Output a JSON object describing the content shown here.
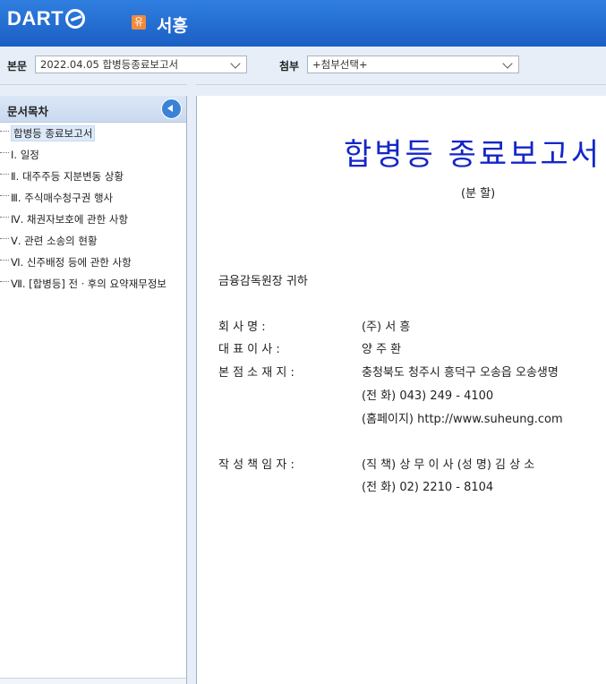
{
  "header": {
    "logo": "DART",
    "company_badge": "유",
    "company_name": "서흥"
  },
  "toolbar": {
    "main_label": "본문",
    "main_select": "2022.04.05  합병등종료보고서",
    "attach_label": "첨부",
    "attach_select": "+첨부선택+"
  },
  "sidebar": {
    "title": "문서목차",
    "items": [
      "합병등 종료보고서",
      "Ⅰ. 일정",
      "Ⅱ. 대주주등 지분변동 상황",
      "Ⅲ. 주식매수청구권 행사",
      "Ⅳ. 채권자보호에 관한 사항",
      "Ⅴ. 관련 소송의 현황",
      "Ⅵ. 신주배정 등에 관한 사항",
      "Ⅶ. [합병등] 전ㆍ후의 요약재무정보"
    ]
  },
  "document": {
    "title": "합병등 종료보고서",
    "subtitle": "(분 할)",
    "addressee": "금융감독원장 귀하",
    "company_label": "회      사      명 :",
    "company_value": "(주) 서 흥",
    "ceo_label": "대    표    이    사 :",
    "ceo_value": "양 주 환",
    "hq_label": "본  점  소  재  지 :",
    "hq_value": "충청북도 청주시 흥덕구 오송읍 오송생명",
    "hq_phone": "(전   화) 043) 249 - 4100",
    "hq_homepage": "(홈페이지) http://www.suheung.com",
    "author_label": "작  성  책  임  자 :",
    "author_value": "(직   책) 상 무 이 사       (성   명) 김 상 소",
    "author_phone": "(전   화) 02) 2210 - 8104"
  }
}
